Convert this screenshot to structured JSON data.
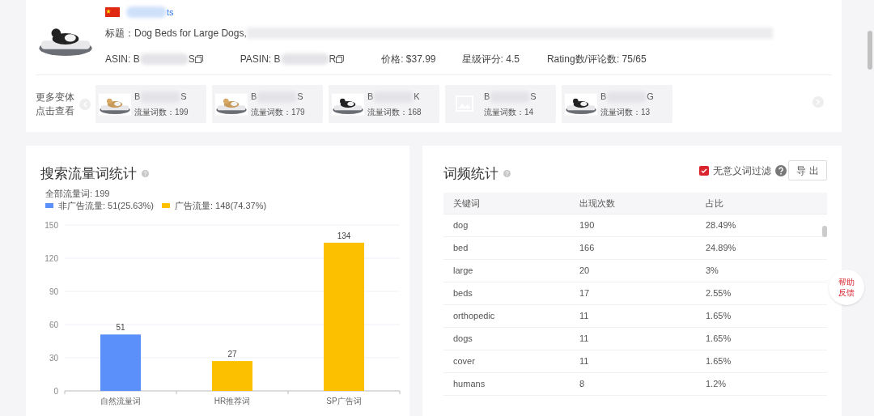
{
  "product": {
    "store_tail": "ts",
    "title": "标题：Dog Beds for Large Dogs,",
    "asin_label": "ASIN: B",
    "asin_tail": "S",
    "pasin_label": "PASIN: B",
    "pasin_tail": "R",
    "price": "价格: $37.99",
    "stars_text": "星级评分: 4.5",
    "rating_text": "Rating数/评论数: 75/65"
  },
  "variants": {
    "label": "更多变体点击查看",
    "items": [
      {
        "head": "B",
        "tail": "S",
        "count": "流量词数：199"
      },
      {
        "head": "B",
        "tail": "S",
        "count": "流量词数：179"
      },
      {
        "head": "B",
        "tail": "K",
        "count": "流量词数：168"
      },
      {
        "head": "B",
        "tail": "S",
        "count": "流量词数：14",
        "kind": "placeholder"
      },
      {
        "head": "B",
        "tail": "G",
        "count": "流量词数：13"
      }
    ]
  },
  "traffic": {
    "title": "搜索流量词统计",
    "total": "全部流量词: 199",
    "legend": [
      {
        "label": "非广告流量: 51(25.63%)",
        "color": "#5b8ff9"
      },
      {
        "label": "广告流量: 148(74.37%)",
        "color": "#fdc000"
      }
    ],
    "chart_data": {
      "type": "bar",
      "categories": [
        "自然流量词",
        "HR推荐词",
        "SP广告词"
      ],
      "values": [
        51,
        27,
        134
      ],
      "grid": true,
      "colors": [
        "#5b8ff9",
        "#fdc000",
        "#fdc000"
      ],
      "ylim": [
        0,
        150
      ],
      "yticks": [
        0,
        30,
        60,
        90,
        120,
        150
      ],
      "data_labels": true
    }
  },
  "frequency": {
    "title": "词频统计",
    "filter": {
      "label": "无意义词过滤",
      "checked": true
    },
    "export": "导 出",
    "columns": [
      "关键词",
      "出现次数",
      "占比"
    ],
    "rows": [
      [
        "dog",
        "190",
        "28.49%"
      ],
      [
        "bed",
        "166",
        "24.89%"
      ],
      [
        "large",
        "20",
        "3%"
      ],
      [
        "beds",
        "17",
        "2.55%"
      ],
      [
        "orthopedic",
        "11",
        "1.65%"
      ],
      [
        "dogs",
        "11",
        "1.65%"
      ],
      [
        "cover",
        "11",
        "1.65%"
      ],
      [
        "humans",
        "8",
        "1.2%"
      ]
    ]
  },
  "help": "帮助反馈"
}
